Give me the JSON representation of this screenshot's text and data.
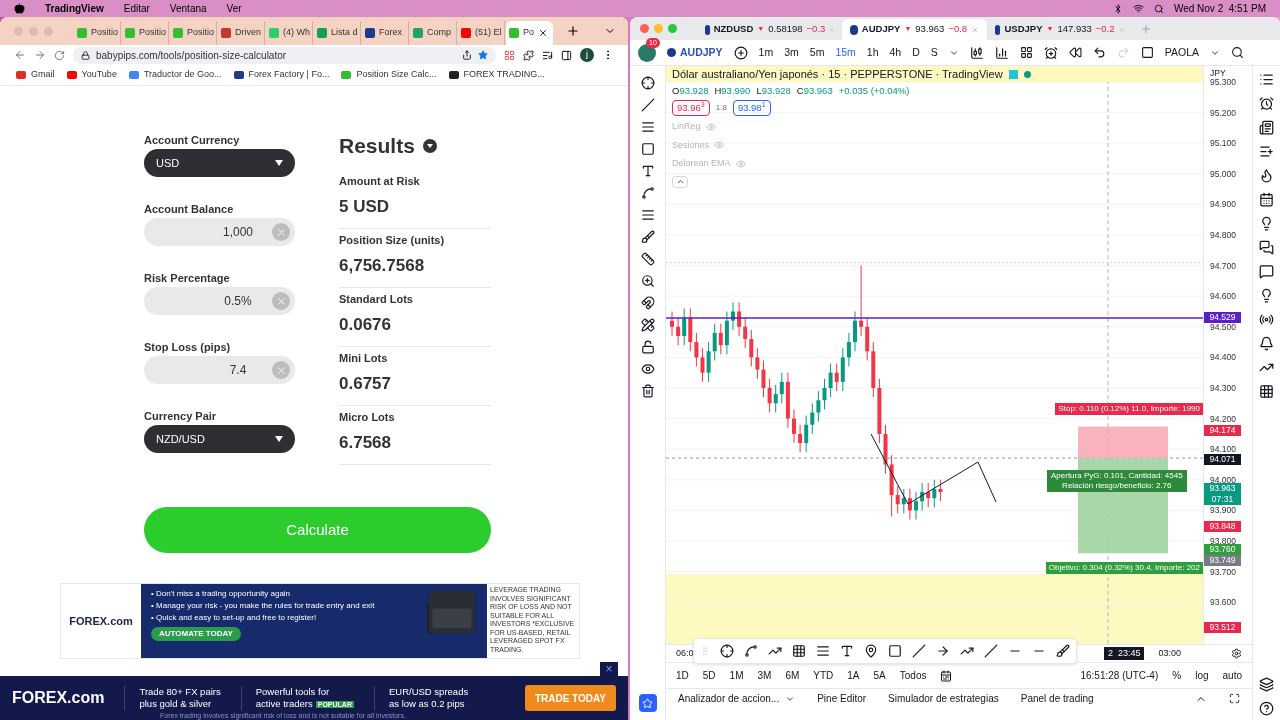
{
  "menu_bar": {
    "app": "TradingView",
    "items": [
      "Editar",
      "Ventana",
      "Ver"
    ],
    "clock": "Wed Nov 2  4:51 PM"
  },
  "browser": {
    "tabs": [
      {
        "title": "Positio",
        "selected": false
      },
      {
        "title": "Positio",
        "selected": false
      },
      {
        "title": "Positio",
        "selected": false
      },
      {
        "title": "Driven",
        "selected": false
      },
      {
        "title": "(4) Wh",
        "selected": false
      },
      {
        "title": "Lista d",
        "selected": false
      },
      {
        "title": "Forex",
        "selected": false
      },
      {
        "title": "Comp",
        "selected": false
      },
      {
        "title": "(51) El",
        "selected": false
      },
      {
        "title": "Po",
        "selected": true
      }
    ],
    "url": "babypips.com/tools/position-size-calculator",
    "profile": "j",
    "bookmarks": [
      {
        "title": "Gmail",
        "color": "#d93025"
      },
      {
        "title": "YouTube",
        "color": "#ff0000"
      },
      {
        "title": "Traductor de Goo...",
        "color": "#4285f4"
      },
      {
        "title": "Forex Factory | Fo...",
        "color": "#1f3a8a"
      },
      {
        "title": "Position Size Calc...",
        "color": "#2fbf2f"
      },
      {
        "title": "FOREX TRADING...",
        "color": "#222222"
      }
    ]
  },
  "calculator": {
    "fields": [
      {
        "label": "Account Currency",
        "kind": "select",
        "value": "USD"
      },
      {
        "label": "Account Balance",
        "kind": "input",
        "value": "1,000"
      },
      {
        "label": "Risk Percentage",
        "kind": "input",
        "value": "0.5%"
      },
      {
        "label": "Stop Loss (pips)",
        "kind": "input",
        "value": "7.4"
      },
      {
        "label": "Currency Pair",
        "kind": "select",
        "value": "NZD/USD"
      }
    ],
    "results_title": "Results",
    "results": [
      {
        "label": "Amount at Risk",
        "value": "5 USD"
      },
      {
        "label": "Position Size (units)",
        "value": "6,756.7568"
      },
      {
        "label": "Standard Lots",
        "value": "0.0676"
      },
      {
        "label": "Mini Lots",
        "value": "0.6757"
      },
      {
        "label": "Micro Lots",
        "value": "6.7568"
      }
    ],
    "button": "Calculate"
  },
  "ad": {
    "logo": "FOREX.com",
    "bullets": [
      "• Don't miss a trading opportunity again",
      "• Manage your risk - you make the rules for trade entry and exit",
      "• Quick and easy to set-up and free to register!"
    ],
    "cta": "AUTOMATE TODAY",
    "disclaimer": "LEVERAGE TRADING INVOLVES SIGNIFICANT RISK OF LOSS AND NOT SUITABLE FOR ALL INVESTORS *EXCLUSIVE FOR US-BASED, RETAIL LEVERAGED SPOT FX TRADING."
  },
  "bottom_ad": {
    "logo": "FOREX.com",
    "close": "×",
    "features": [
      {
        "lines": [
          "Trade 80+ FX pairs",
          "plus gold & silver"
        ]
      },
      {
        "lines": [
          "Powerful tools for",
          "active traders"
        ],
        "badge": "POPULAR"
      },
      {
        "lines": [
          "EUR/USD spreads",
          "as low as 0.2 pips"
        ]
      }
    ],
    "cta": "TRADE TODAY",
    "disclaimer": "Forex trading involves significant risk of loss and is not suitable for all investors."
  },
  "tv": {
    "tabs": [
      {
        "symbol": "NZDUSD",
        "arrow": "▼",
        "price": "0.58198",
        "change": "−0.3",
        "selected": false
      },
      {
        "symbol": "AUDJPY",
        "arrow": "▼",
        "price": "93.963",
        "change": "−0.8",
        "selected": true
      },
      {
        "symbol": "USDJPY",
        "arrow": "▼",
        "price": "147.933",
        "change": "−0.2",
        "selected": false
      }
    ],
    "notifications": "10",
    "symbol": "AUDJPY",
    "intervals": [
      {
        "label": "1m",
        "selected": false
      },
      {
        "label": "3m",
        "selected": false
      },
      {
        "label": "5m",
        "selected": false
      },
      {
        "label": "15m",
        "selected": true
      },
      {
        "label": "1h",
        "selected": false
      },
      {
        "label": "4h",
        "selected": false
      },
      {
        "label": "D",
        "selected": false
      },
      {
        "label": "S",
        "selected": false
      }
    ],
    "layout": "PAOLA",
    "legend": {
      "title": "Dólar australiano/Yen japonés · 15 · PEPPERSTONE · TradingView",
      "ohlc": [
        {
          "key": "O",
          "value": "93.928"
        },
        {
          "key": "H",
          "value": "93.990"
        },
        {
          "key": "L",
          "value": "93.928"
        },
        {
          "key": "C",
          "value": "93.963"
        }
      ],
      "change": "+0.035 (+0.04%)",
      "sell": "93.96$^{3}$",
      "spread": "1.8",
      "buy": "93.98$^{1}$",
      "indicators": [
        "LinReg",
        "Sesiones",
        "Delorean EMA"
      ]
    },
    "currency": "JPY",
    "ticks": [
      "95.300",
      "95.200",
      "95.100",
      "95.000",
      "94.900",
      "94.800",
      "94.700",
      "94.600",
      "94.500",
      "94.400",
      "94.300",
      "94.200",
      "94.100",
      "94.000",
      "93.900",
      "93.800",
      "93.700",
      "93.600"
    ],
    "price_labels": [
      {
        "lines": [
          "94.529"
        ],
        "color": "#5b1fc9"
      },
      {
        "lines": [
          "94.174"
        ],
        "color": "#e8294b"
      },
      {
        "lines": [
          "94.071"
        ],
        "color": "#131722"
      },
      {
        "lines": [
          "93.963",
          "07:31"
        ],
        "color": "#089981"
      },
      {
        "lines": [
          "93.848"
        ],
        "color": "#e8294b"
      },
      {
        "lines": [
          "93.760"
        ],
        "color": "#2e9e3e"
      },
      {
        "lines": [
          "93.749"
        ],
        "color": "#787b86"
      },
      {
        "lines": [
          "93.512"
        ],
        "color": "#e8294b"
      }
    ],
    "position": {
      "stop": "Stop: 0.110 (0.12%) 11.0, Importe: 1990",
      "info": [
        "Apertura PyG: 0.101, Cantidad: 4545",
        "Relación riesgo/beneficio: 2.76"
      ],
      "target": "Objetivo: 0.304 (0.32%) 30.4, Importe: 202"
    },
    "time_axis": [
      "06:0",
      "2  23:45",
      "03:00"
    ],
    "ranges": [
      "1D",
      "5D",
      "1M",
      "3M",
      "6M",
      "YTD",
      "1A",
      "5A",
      "Todos"
    ],
    "clock": "16:51:28 (UTC-4)",
    "scale": [
      "%",
      "log",
      "auto"
    ],
    "bottom_tabs": [
      "Analizador de accion...",
      "Pine Editor",
      "Simulador de estrategias",
      "Panel de trading"
    ]
  }
}
